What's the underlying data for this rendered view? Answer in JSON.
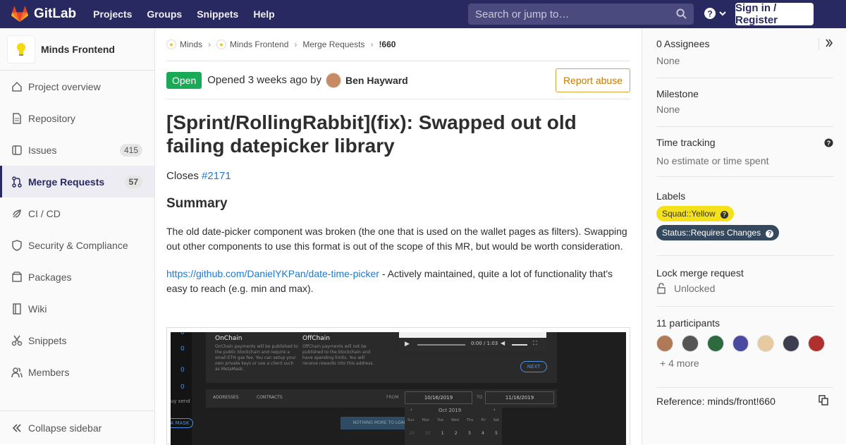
{
  "brand": {
    "name": "GitLab"
  },
  "topnav": {
    "projects": "Projects",
    "groups": "Groups",
    "snippets": "Snippets",
    "help": "Help"
  },
  "search": {
    "placeholder": "Search or jump to…"
  },
  "signin": "Sign in / Register",
  "sidebar": {
    "project": "Minds Frontend",
    "items": [
      {
        "label": "Project overview"
      },
      {
        "label": "Repository"
      },
      {
        "label": "Issues",
        "count": "415"
      },
      {
        "label": "Merge Requests",
        "count": "57"
      },
      {
        "label": "CI / CD"
      },
      {
        "label": "Security & Compliance"
      },
      {
        "label": "Packages"
      },
      {
        "label": "Wiki"
      },
      {
        "label": "Snippets"
      },
      {
        "label": "Members"
      }
    ],
    "collapse": "Collapse sidebar"
  },
  "breadcrumb": [
    "Minds",
    "Minds Frontend",
    "Merge Requests",
    "!660"
  ],
  "mr": {
    "status": "Open",
    "opened": "Opened 3 weeks ago by",
    "author": "Ben Hayward",
    "report": "Report abuse",
    "title": "[Sprint/RollingRabbit](fix): Swapped out old failing datepicker library",
    "closes_prefix": "Closes ",
    "closes_link": "#2171",
    "summary_heading": "Summary",
    "para1": "The old date-picker component was broken (the one that is used on the wallet pages as filters). Swapping out other components to use this format is out of the scope of this MR, but would be worth consideration.",
    "link": "https://github.com/DanielYKPan/date-time-picker",
    "link_rest": " - Actively maintained, quite a lot of functionality that's easy to reach (e.g. min and max)."
  },
  "shot": {
    "onchain": "OnChain",
    "onchain_text": "OnChain payments will be published to the public blockchain and require a small ETH gas fee. You can setup your own private keys or use a client such as MetaMask.",
    "offchain": "OffChain",
    "offchain_text": "OffChain payments will not be published to the blockchain and have spending limits. You will receive rewards into this address.",
    "time": "0:00 / 1:03",
    "next": "NEXT",
    "addresses": "ADDRESSES",
    "contracts": "CONTRACTS",
    "from": "FROM",
    "to": "TO",
    "date_from": "10/16/2019",
    "date_to": "11/16/2019",
    "month": "Oct 2019",
    "days": [
      "Sun",
      "Mon",
      "Tue",
      "Wed",
      "Thu",
      "Fri",
      "Sat"
    ],
    "nums": [
      "29",
      "30",
      "1",
      "2",
      "3",
      "4",
      "5"
    ],
    "nothing": "NOTHING MORE TO LOAD",
    "zeros": [
      "0",
      "0",
      "0",
      "0"
    ],
    "buy": "uy send",
    "mask": "A MASK"
  },
  "right": {
    "assignees": "0 Assignees",
    "assignees_val": "None",
    "milestone": "Milestone",
    "milestone_val": "None",
    "time": "Time tracking",
    "time_val": "No estimate or time spent",
    "labels": "Labels",
    "label1": "Squad::Yellow",
    "label2": "Status::Requires Changes",
    "lock": "Lock merge request",
    "lock_val": "Unlocked",
    "participants": "11 participants",
    "more": "+ 4 more",
    "reference": "Reference: minds/front!660"
  },
  "colors": {
    "topbar": "#292961",
    "label_yellow": "#f5e11a",
    "label_dark": "#34495e",
    "open": "#1aaa55"
  }
}
